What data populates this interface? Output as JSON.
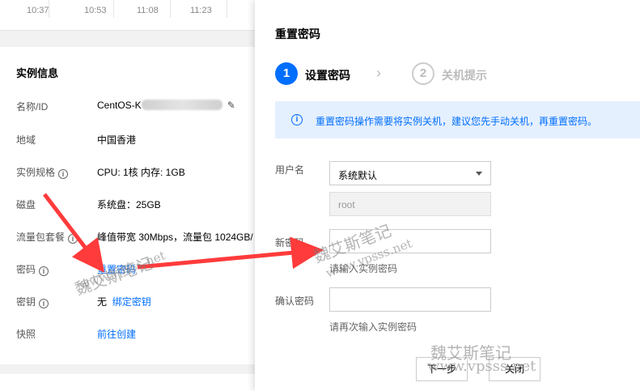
{
  "chart": {
    "ticks": [
      "10:37",
      "10:53",
      "11:08",
      "11:23"
    ]
  },
  "instance_info": {
    "title": "实例信息",
    "rows": [
      {
        "label": "名称/ID",
        "value": "CentOS-K"
      },
      {
        "label": "地域",
        "value": "中国香港"
      },
      {
        "label": "实例规格",
        "value": "CPU: 1核 内存: 1GB"
      },
      {
        "label": "磁盘",
        "value": "系统盘：25GB"
      },
      {
        "label": "流量包套餐",
        "value": "峰值带宽 30Mbps，流量包 1024GB/"
      },
      {
        "label": "密码",
        "value": "重置密码"
      },
      {
        "label": "密钥",
        "value": "无",
        "link": "绑定密钥"
      },
      {
        "label": "快照",
        "value": "前往创建"
      }
    ],
    "help_glyph": "i",
    "edit_icon": "pencil-icon"
  },
  "dialog": {
    "title": "重置密码",
    "steps": [
      {
        "number": "1",
        "label": "设置密码"
      },
      {
        "number": "2",
        "label": "关机提示"
      }
    ],
    "chevron": "›",
    "notice": {
      "icon": "info-icon",
      "glyph": "i",
      "text": "重置密码操作需要将实例关机，建议您先手动关机，再重置密码。"
    },
    "username": {
      "label": "用户名",
      "selected": "系统默认",
      "readonly_value": "root"
    },
    "new_password": {
      "label": "新密码",
      "value": "",
      "hint": "请输入实例密码"
    },
    "confirm_password": {
      "label": "确认密码",
      "value": "",
      "hint": "请再次输入实例密码"
    },
    "buttons": {
      "next": "下一步",
      "close": "关闭"
    }
  },
  "watermarks": {
    "text_cn": "魏艾斯笔记",
    "text_url": "www.vpsss.net"
  },
  "colors": {
    "accent": "#006eff",
    "arrow": "#ff3b3b",
    "notice_bg": "#e5f0ff"
  }
}
